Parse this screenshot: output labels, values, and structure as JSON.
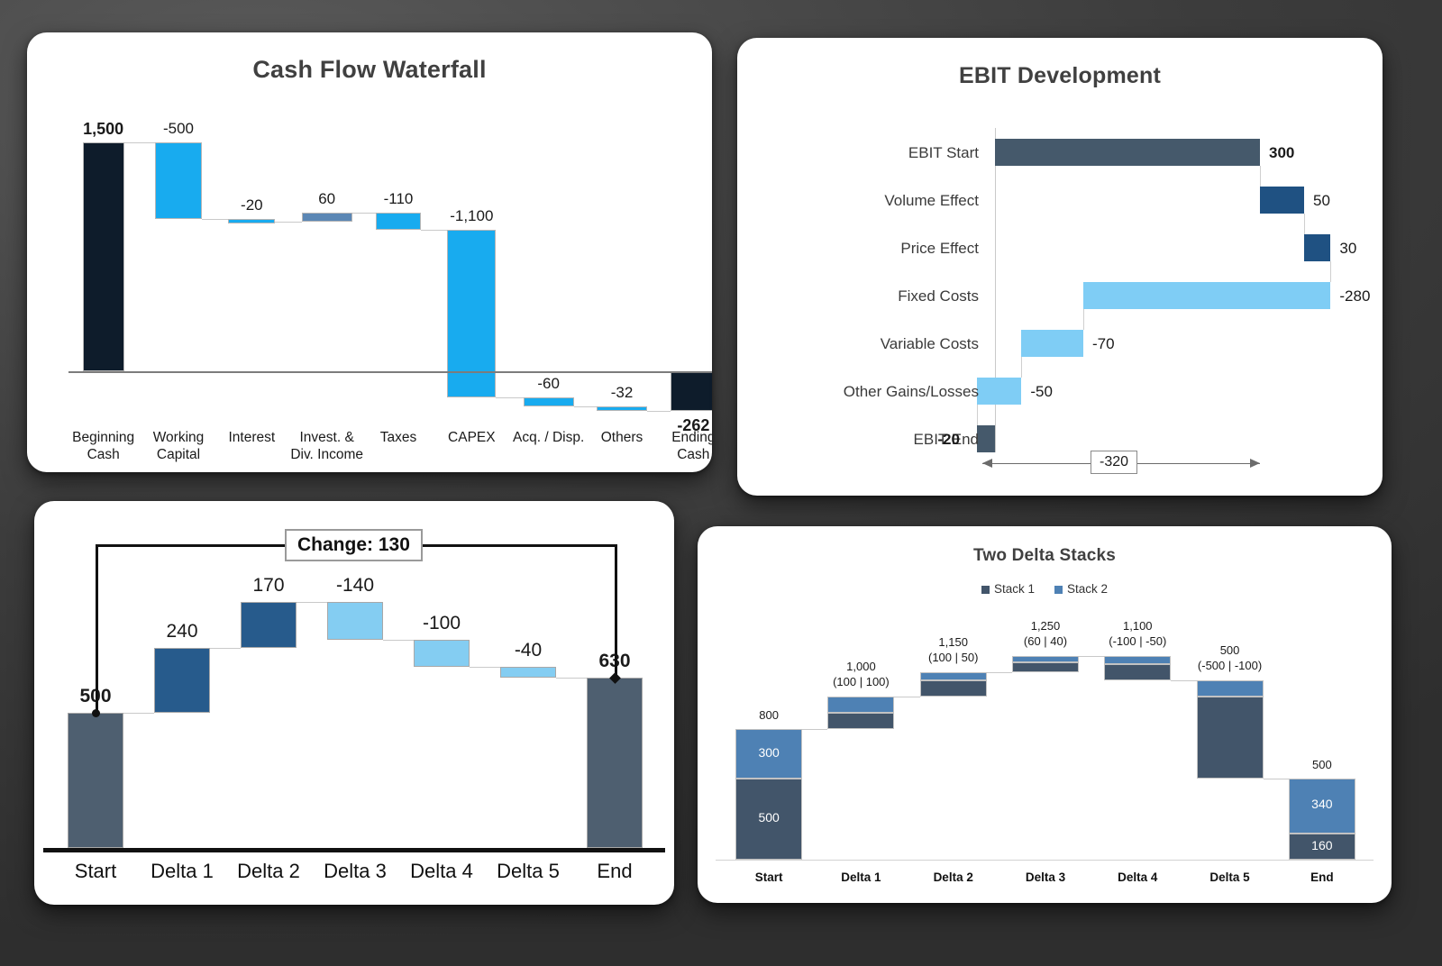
{
  "chart_data": [
    {
      "type": "bar",
      "chart_name": "cash-flow-waterfall",
      "title": "Cash Flow Waterfall",
      "subtype": "waterfall",
      "xlabel": "",
      "ylabel": "",
      "grid": false,
      "legend": "none",
      "categories": [
        "Beginning\nCash",
        "Working\nCapital",
        "Interest",
        "Invest. &\nDiv. Income",
        "Taxes",
        "CAPEX",
        "Acq. / Disp.",
        "Others",
        "Ending\nCash"
      ],
      "values": [
        1500,
        -500,
        -20,
        60,
        -110,
        -1100,
        -60,
        -32,
        -262
      ],
      "labels": [
        "1,500",
        "-500",
        "-20",
        "60",
        "-110",
        "-1,100",
        "-60",
        "-32",
        "-262"
      ],
      "kinds": [
        "total",
        "delta",
        "delta",
        "delta",
        "delta",
        "delta",
        "delta",
        "delta",
        "total"
      ],
      "cumulative": [
        1500,
        1000,
        980,
        1040,
        930,
        -170,
        -230,
        -262,
        -262
      ],
      "ylim": [
        -400,
        1600
      ]
    },
    {
      "type": "bar",
      "chart_name": "ebit-development",
      "title": "EBIT Development",
      "subtype": "horizontal-waterfall",
      "xlabel": "",
      "ylabel": "",
      "grid": false,
      "legend": "none",
      "categories": [
        "EBIT Start",
        "Volume Effect",
        "Price Effect",
        "Fixed Costs",
        "Variable Costs",
        "Other Gains/Losses",
        "EBIT End"
      ],
      "values": [
        300,
        50,
        30,
        -280,
        -70,
        -50,
        -20
      ],
      "labels": [
        "300",
        "50",
        "30",
        "-280",
        "-70",
        "-50",
        "-20"
      ],
      "kinds": [
        "total",
        "delta",
        "delta",
        "delta",
        "delta",
        "delta",
        "total"
      ],
      "cumulative": [
        300,
        350,
        380,
        100,
        30,
        -20,
        -20
      ],
      "annotation": "-320",
      "xlim": [
        -60,
        400
      ]
    },
    {
      "type": "bar",
      "chart_name": "change-waterfall",
      "title": "",
      "subtype": "waterfall",
      "xlabel": "",
      "ylabel": "",
      "grid": false,
      "legend": "none",
      "categories": [
        "Start",
        "Delta 1",
        "Delta 2",
        "Delta 3",
        "Delta 4",
        "Delta 5",
        "End"
      ],
      "values": [
        500,
        240,
        170,
        -140,
        -100,
        -40,
        630
      ],
      "labels": [
        "500",
        "240",
        "170",
        "-140",
        "-100",
        "-40",
        "630"
      ],
      "kinds": [
        "total",
        "delta",
        "delta",
        "delta",
        "delta",
        "delta",
        "total"
      ],
      "cumulative": [
        500,
        740,
        910,
        770,
        670,
        630,
        630
      ],
      "annotation": "Change: 130",
      "ylim": [
        0,
        1000
      ]
    },
    {
      "type": "bar",
      "chart_name": "two-delta-stacks",
      "title": "Two Delta Stacks",
      "subtype": "stacked-waterfall",
      "xlabel": "",
      "ylabel": "",
      "grid": false,
      "legend_position": "top-center",
      "categories": [
        "Start",
        "Delta 1",
        "Delta 2",
        "Delta 3",
        "Delta 4",
        "Delta 5",
        "End"
      ],
      "series": [
        {
          "name": "Stack 1",
          "values": [
            500,
            100,
            100,
            60,
            -100,
            -500,
            160
          ],
          "color": "#42556a"
        },
        {
          "name": "Stack 2",
          "values": [
            300,
            100,
            50,
            40,
            -50,
            -100,
            340
          ],
          "color": "#4e81b4"
        }
      ],
      "totals": [
        800,
        1000,
        1150,
        1250,
        1100,
        500,
        500
      ],
      "total_labels": [
        "800",
        "1,000",
        "1,150",
        "1,250",
        "1,100",
        "500",
        "500"
      ],
      "delta_labels": [
        "",
        "(100 | 100)",
        "(100 | 50)",
        "(60 | 40)",
        "(-100 | -50)",
        "(-500 | -100)",
        ""
      ],
      "inner_labels": {
        "start": [
          "300",
          "500"
        ],
        "end": [
          "340",
          "160"
        ]
      },
      "ylim": [
        0,
        1400
      ]
    }
  ],
  "cards": {
    "card1": {
      "title": "Cash Flow Waterfall"
    },
    "card2": {
      "title": "EBIT Development",
      "arrow_label": "-320"
    },
    "card3": {
      "callout": "Change: 130"
    },
    "card4": {
      "title": "Two Delta Stacks",
      "legend": [
        "Stack 1",
        "Stack 2"
      ]
    }
  },
  "colors": {
    "cash_total": "#0e1c2b",
    "cash_negative": "#18abef",
    "cash_positive": "#5b87b5",
    "ebit_total": "#45596b",
    "ebit_positive": "#1f5182",
    "ebit_negative": "#7fcdf5",
    "change_total": "#4e5f70",
    "change_positive": "#275b8c",
    "change_negative": "#84cdf2",
    "stack1": "#42556a",
    "stack2": "#4e81b4",
    "background": "#3c3c3c",
    "card": "#ffffff"
  }
}
